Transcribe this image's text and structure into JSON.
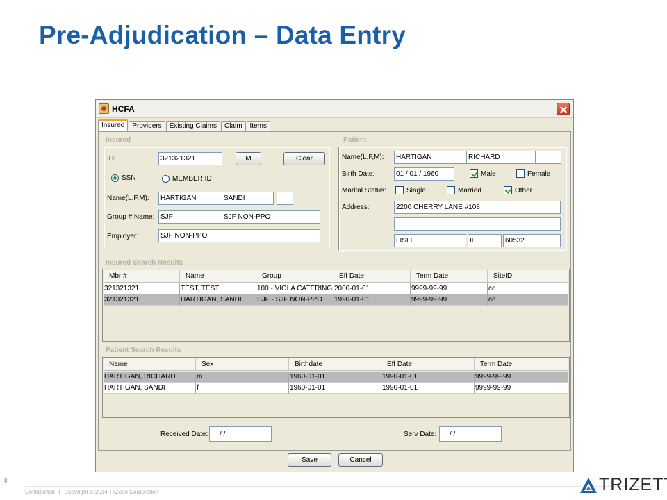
{
  "slide": {
    "title": "Pre-Adjudication – Data Entry",
    "page_number": "8",
    "footer_confidential": "Confidential",
    "footer_separator": "|",
    "footer_copyright": "Copyright © 2014 TriZetto Corporation",
    "logo_text": "TRIZETTO",
    "brand_color": "#1b5fa8"
  },
  "window": {
    "title": "HCFA",
    "tabs": [
      "Insured",
      "Providers",
      "Existing Claims",
      "Claim",
      "Items"
    ],
    "active_tab": "Insured"
  },
  "insured": {
    "group_title": "Insured",
    "id_label": "ID:",
    "id_value": "321321321",
    "m_button": "M",
    "clear_button": "Clear",
    "ssn_label": "SSN",
    "member_id_label": "MEMBER ID",
    "id_type_selected": "SSN",
    "name_label": "Name(L,F,M):",
    "last_name": "HARTIGAN",
    "first_name": "SANDI",
    "middle_name": "",
    "group_label": "Group #,Name:",
    "group_number": "SJF",
    "group_name": "SJF NON-PPO",
    "employer_label": "Employer:",
    "employer": "SJF NON-PPO"
  },
  "patient": {
    "group_title": "Patient",
    "name_label": "Name(L,F,M):",
    "last_name": "HARTIGAN",
    "first_name": "RICHARD",
    "middle_name": "",
    "birth_label": "Birth Date:",
    "birth_date": "01 / 01 / 1960",
    "male_label": "Male",
    "female_label": "Female",
    "male_checked": true,
    "female_checked": false,
    "marital_label": "Marital Status:",
    "single_label": "Single",
    "married_label": "Married",
    "other_label": "Other",
    "single_checked": false,
    "married_checked": false,
    "other_checked": true,
    "address_label": "Address:",
    "address1": "2200 CHERRY LANE #108",
    "address2": "",
    "city": "LISLE",
    "state": "IL",
    "zip": "60532"
  },
  "insured_results": {
    "title": "Insured Search Results",
    "columns": [
      "Mbr #",
      "Name",
      "Group",
      "Eff Date",
      "Term Date",
      "SiteID"
    ],
    "rows": [
      {
        "mbr": "321321321",
        "name": "TEST, TEST",
        "group": "100 - VIOLA CATERING",
        "eff": "2000-01-01",
        "term": "9999-99-99",
        "site": "ce",
        "selected": false
      },
      {
        "mbr": "321321321",
        "name": "HARTIGAN, SANDI",
        "group": "SJF - SJF NON-PPO",
        "eff": "1990-01-01",
        "term": "9999-99-99",
        "site": "ce",
        "selected": true
      }
    ]
  },
  "patient_results": {
    "title": "Patient Search Results",
    "columns": [
      "Name",
      "Sex",
      "Birthdate",
      "Eff Date",
      "Term Date"
    ],
    "rows": [
      {
        "name": "HARTIGAN, RICHARD",
        "sex": "m",
        "birth": "1960-01-01",
        "eff": "1990-01-01",
        "term": "9999-99-99",
        "selected": true
      },
      {
        "name": "HARTIGAN, SANDI",
        "sex": "f",
        "birth": "1960-01-01",
        "eff": "1990-01-01",
        "term": "9999-99-99",
        "selected": false
      }
    ]
  },
  "dates": {
    "received_label": "Received Date:",
    "received_value": "/     /",
    "serv_label": "Serv Date:",
    "serv_value": "/     /"
  },
  "actions": {
    "save": "Save",
    "cancel": "Cancel"
  }
}
